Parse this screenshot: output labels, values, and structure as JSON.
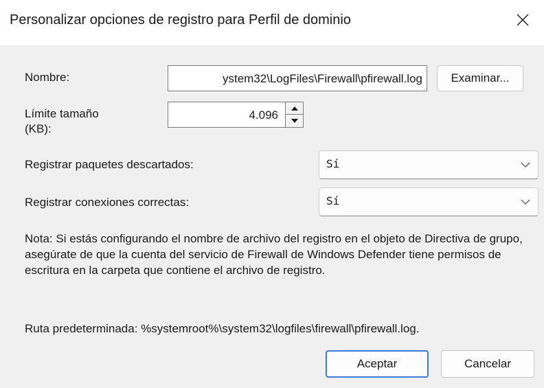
{
  "window": {
    "title": "Personalizar opciones de registro para Perfil de dominio",
    "close_icon": "close-icon"
  },
  "name_row": {
    "label": "Nombre:",
    "value": "ystem32\\LogFiles\\Firewall\\pfirewall.log",
    "browse_label": "Examinar..."
  },
  "size_row": {
    "label_line1": "Límite tamaño",
    "label_line2": "(KB):",
    "value": "4.096"
  },
  "dropped_row": {
    "label": "Registrar paquetes descartados:",
    "selected": "Sí"
  },
  "success_row": {
    "label": "Registrar conexiones correctas:",
    "selected": "Sí"
  },
  "note": "Nota: Si estás configurando el nombre de archivo del registro en el objeto de Directiva de grupo, asegúrate de que la cuenta del servicio de Firewall de Windows Defender tiene permisos de escritura en la carpeta que contiene el archivo de registro.",
  "default_path": "Ruta predeterminada: %systemroot%\\system32\\logfiles\\firewall\\pfirewall.log.",
  "buttons": {
    "ok": "Aceptar",
    "cancel": "Cancelar"
  },
  "colors": {
    "accent": "#3a7bd5",
    "background": "#f0f0f0"
  }
}
